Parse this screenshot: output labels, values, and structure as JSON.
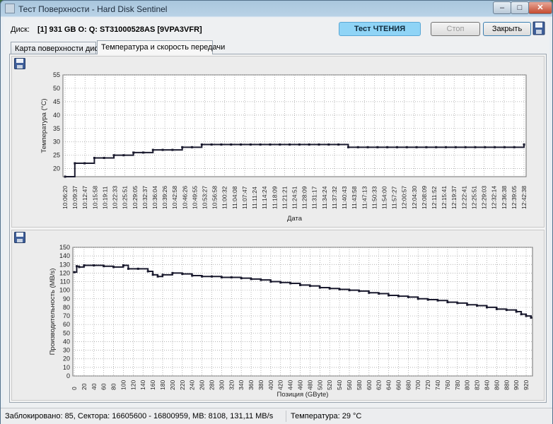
{
  "window": {
    "title": "Тест Поверхности - Hard Disk Sentinel"
  },
  "disk": {
    "label": "Диск:",
    "value": "[1] 931 GB O: Q: ST31000528AS [9VPA3VFR]"
  },
  "buttons": {
    "test": "Тест ЧТЕНИЯ",
    "stop": "Стоп",
    "close": "Закрыть"
  },
  "tabs": {
    "surface": "Карта поверхности диска",
    "temp": "Температура и скорость передачи"
  },
  "chart_data": [
    {
      "type": "line",
      "xlabel": "Дата",
      "ylabel": "Температура (°C)",
      "ylim": [
        17,
        55
      ],
      "yticks": [
        20,
        25,
        30,
        35,
        40,
        45,
        50,
        55
      ],
      "grid": true,
      "categories": [
        "10:06:20",
        "10:09:37",
        "10:12:47",
        "10:15:58",
        "10:19:11",
        "10:22:33",
        "10:25:51",
        "10:29:05",
        "10:32:37",
        "10:36:04",
        "10:39:26",
        "10:42:58",
        "10:46:26",
        "10:49:55",
        "10:53:27",
        "10:56:58",
        "11:00:32",
        "11:04:08",
        "11:07:47",
        "11:11:24",
        "11:14:24",
        "11:18:09",
        "11:21:21",
        "11:24:51",
        "11:28:09",
        "11:31:17",
        "11:34:24",
        "11:37:32",
        "11:40:43",
        "11:43:58",
        "11:47:13",
        "11:50:33",
        "11:54:00",
        "11:57:27",
        "12:00:57",
        "12:04:30",
        "12:08:09",
        "12:11:52",
        "12:15:41",
        "12:19:37",
        "12:22:41",
        "12:25:51",
        "12:29:03",
        "12:32:14",
        "12:36:38",
        "12:39:05",
        "12:42:38"
      ],
      "series": [
        {
          "values": [
            17,
            22,
            22,
            24,
            24,
            25,
            25,
            26,
            26,
            27,
            27,
            27,
            28,
            28,
            29,
            29,
            29,
            29,
            29,
            29,
            29,
            29,
            29,
            29,
            29,
            29,
            29,
            29,
            29,
            28,
            28,
            28,
            28,
            28,
            28,
            28,
            28,
            28,
            28,
            28,
            28,
            28,
            28,
            28,
            28,
            28,
            28,
            29
          ]
        }
      ]
    },
    {
      "type": "line",
      "xlabel": "Позиция (GByte)",
      "ylabel": "Производительность (MB/s)",
      "ylim": [
        0,
        150
      ],
      "yticks": [
        0,
        10,
        20,
        30,
        40,
        50,
        60,
        70,
        80,
        90,
        100,
        110,
        120,
        130,
        140,
        150
      ],
      "xlim": [
        0,
        930
      ],
      "xticks": [
        0,
        20,
        40,
        60,
        80,
        100,
        120,
        140,
        160,
        180,
        200,
        220,
        240,
        260,
        280,
        300,
        320,
        340,
        360,
        380,
        400,
        420,
        440,
        460,
        480,
        500,
        520,
        540,
        560,
        580,
        600,
        620,
        640,
        660,
        680,
        700,
        720,
        740,
        760,
        780,
        800,
        820,
        840,
        860,
        880,
        900,
        920
      ],
      "grid": true,
      "series": [
        {
          "x": [
            0,
            5,
            10,
            20,
            40,
            60,
            80,
            100,
            110,
            130,
            150,
            160,
            170,
            180,
            200,
            220,
            240,
            260,
            280,
            300,
            320,
            340,
            360,
            380,
            400,
            420,
            440,
            460,
            480,
            500,
            520,
            540,
            560,
            580,
            600,
            620,
            640,
            660,
            680,
            700,
            720,
            740,
            760,
            780,
            800,
            820,
            840,
            860,
            880,
            900,
            910,
            920,
            930
          ],
          "y": [
            121,
            128,
            127,
            129,
            129,
            128,
            127,
            129,
            125,
            125,
            122,
            118,
            116,
            118,
            120,
            119,
            117,
            116,
            116,
            115,
            115,
            114,
            113,
            112,
            110,
            109,
            108,
            106,
            105,
            103,
            102,
            101,
            100,
            99,
            97,
            96,
            94,
            93,
            92,
            90,
            89,
            88,
            86,
            85,
            83,
            82,
            80,
            78,
            77,
            75,
            72,
            70,
            68
          ]
        }
      ]
    }
  ],
  "status": {
    "left": "Заблокировано: 85, Сектора: 16605600 - 16800959, MB: 8108, 131,11 MB/s",
    "right": "Температура: 29  °C"
  },
  "colors": {
    "line": "#1a1a2e",
    "grid": "#9a9a9a",
    "plot_bg": "#ffffff",
    "accent": "#8fd4f6"
  }
}
